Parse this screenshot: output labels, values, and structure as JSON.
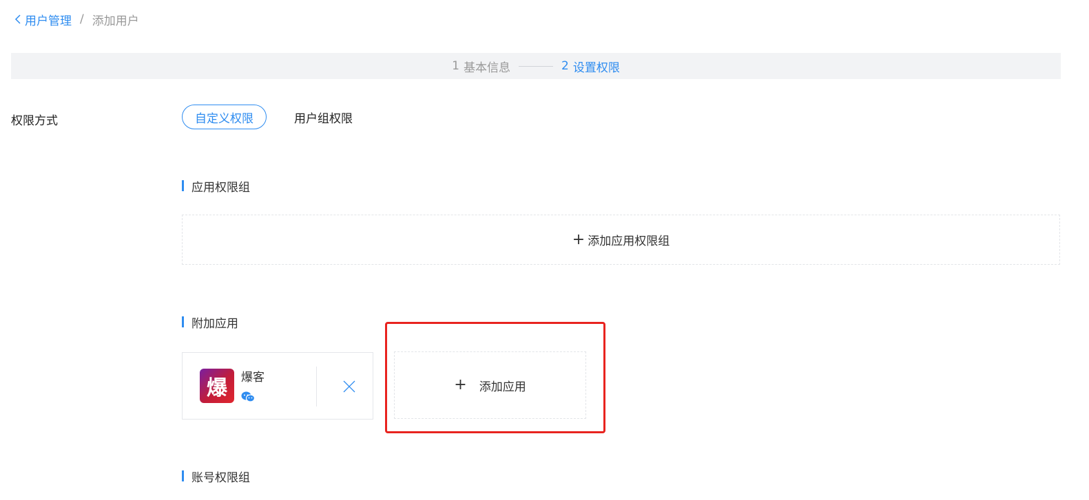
{
  "breadcrumb": {
    "back_label": "用户管理",
    "separator": "/",
    "current": "添加用户"
  },
  "steps": [
    {
      "number": "1",
      "label": "基本信息",
      "status": "done"
    },
    {
      "number": "2",
      "label": "设置权限",
      "status": "active"
    }
  ],
  "permission_mode": {
    "label": "权限方式",
    "options": [
      {
        "label": "自定义权限",
        "selected": true
      },
      {
        "label": "用户组权限",
        "selected": false
      }
    ]
  },
  "sections": {
    "app_permission_group": {
      "title": "应用权限组",
      "add_label": "添加应用权限组"
    },
    "extra_apps": {
      "title": "附加应用",
      "apps": [
        {
          "name": "爆客",
          "icon_glyph": "爆",
          "platform_icon": "wechat-icon"
        }
      ],
      "add_label": "添加应用"
    },
    "account_permission_group": {
      "title": "账号权限组"
    }
  },
  "colors": {
    "accent": "#2e8cf0",
    "highlight": "#e8231f",
    "muted_text": "#999999",
    "steps_background": "#f2f3f5"
  }
}
